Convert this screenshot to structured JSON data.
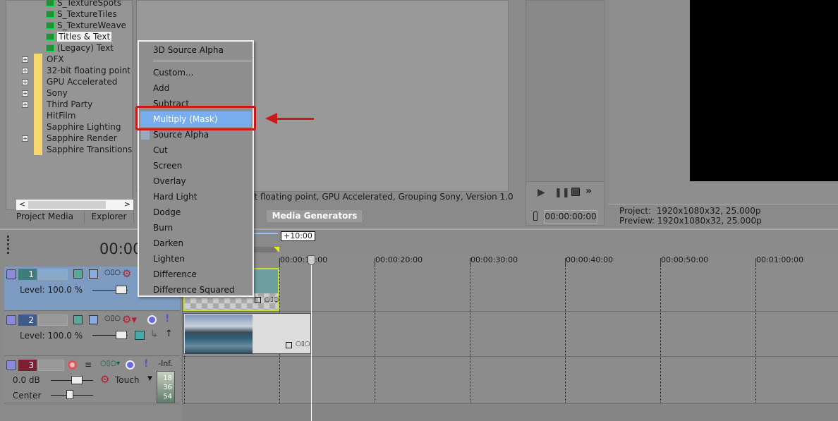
{
  "tree": {
    "items": [
      {
        "label": "S_TextureSpots",
        "type": "plugin"
      },
      {
        "label": "S_TextureTiles",
        "type": "plugin"
      },
      {
        "label": "S_TextureWeave",
        "type": "plugin"
      },
      {
        "label": "Titles & Text",
        "type": "plugin",
        "selected": true
      },
      {
        "label": "(Legacy) Text",
        "type": "plugin"
      },
      {
        "label": "OFX",
        "type": "folder",
        "expandable": true
      },
      {
        "label": "32-bit floating point",
        "type": "folder",
        "expandable": true
      },
      {
        "label": "GPU Accelerated",
        "type": "folder",
        "expandable": true
      },
      {
        "label": "Sony",
        "type": "folder",
        "expandable": true
      },
      {
        "label": "Third Party",
        "type": "folder",
        "expandable": true
      },
      {
        "label": "HitFilm",
        "type": "folder",
        "expandable": false
      },
      {
        "label": "Sapphire Lighting",
        "type": "folder",
        "expandable": false
      },
      {
        "label": "Sapphire Render",
        "type": "folder",
        "expandable": true
      },
      {
        "label": "Sapphire Transitions",
        "type": "folder",
        "expandable": false
      }
    ]
  },
  "tabs": {
    "project_media": "Project Media",
    "explorer": "Explorer",
    "media_generators": "Media Generators"
  },
  "status_text": "it floating point, GPU Accelerated, Grouping Sony, Version 1.0",
  "preview": {
    "timecode": "00:00:00:00",
    "project": "Project:  1920x1080x32, 25.000p",
    "preview_info": "Preview: 1920x1080x32, 25.000p"
  },
  "context_menu": {
    "items": [
      "3D Source Alpha",
      "Custom...",
      "Add",
      "Subtract",
      "Multiply (Mask)",
      "Source Alpha",
      "Cut",
      "Screen",
      "Overlay",
      "Hard Light",
      "Dodge",
      "Burn",
      "Darken",
      "Lighten",
      "Difference",
      "Difference Squared"
    ],
    "highlighted": "Multiply (Mask)",
    "checked": "Source Alpha",
    "highlight_color": "#78aef0",
    "annotation_color": "#c81a1a"
  },
  "timeline": {
    "cursor_time": "00:00",
    "region_length": "+10:00",
    "ruler": [
      "00:00:10:00",
      "00:00:20:00",
      "00:00:30:00",
      "00:00:40:00",
      "00:00:50:00",
      "00:01:00:00"
    ]
  },
  "tracks": [
    {
      "number": "1",
      "level": "Level: 100.0 %",
      "kind": "video"
    },
    {
      "number": "2",
      "level": "Level: 100.0 %",
      "kind": "video"
    },
    {
      "number": "3",
      "volume": "0.0 dB",
      "pan": "Center",
      "automation": "Touch",
      "meter_top": "-Inf.",
      "meter_ticks": [
        "18",
        "36",
        "54"
      ],
      "kind": "audio"
    }
  ]
}
